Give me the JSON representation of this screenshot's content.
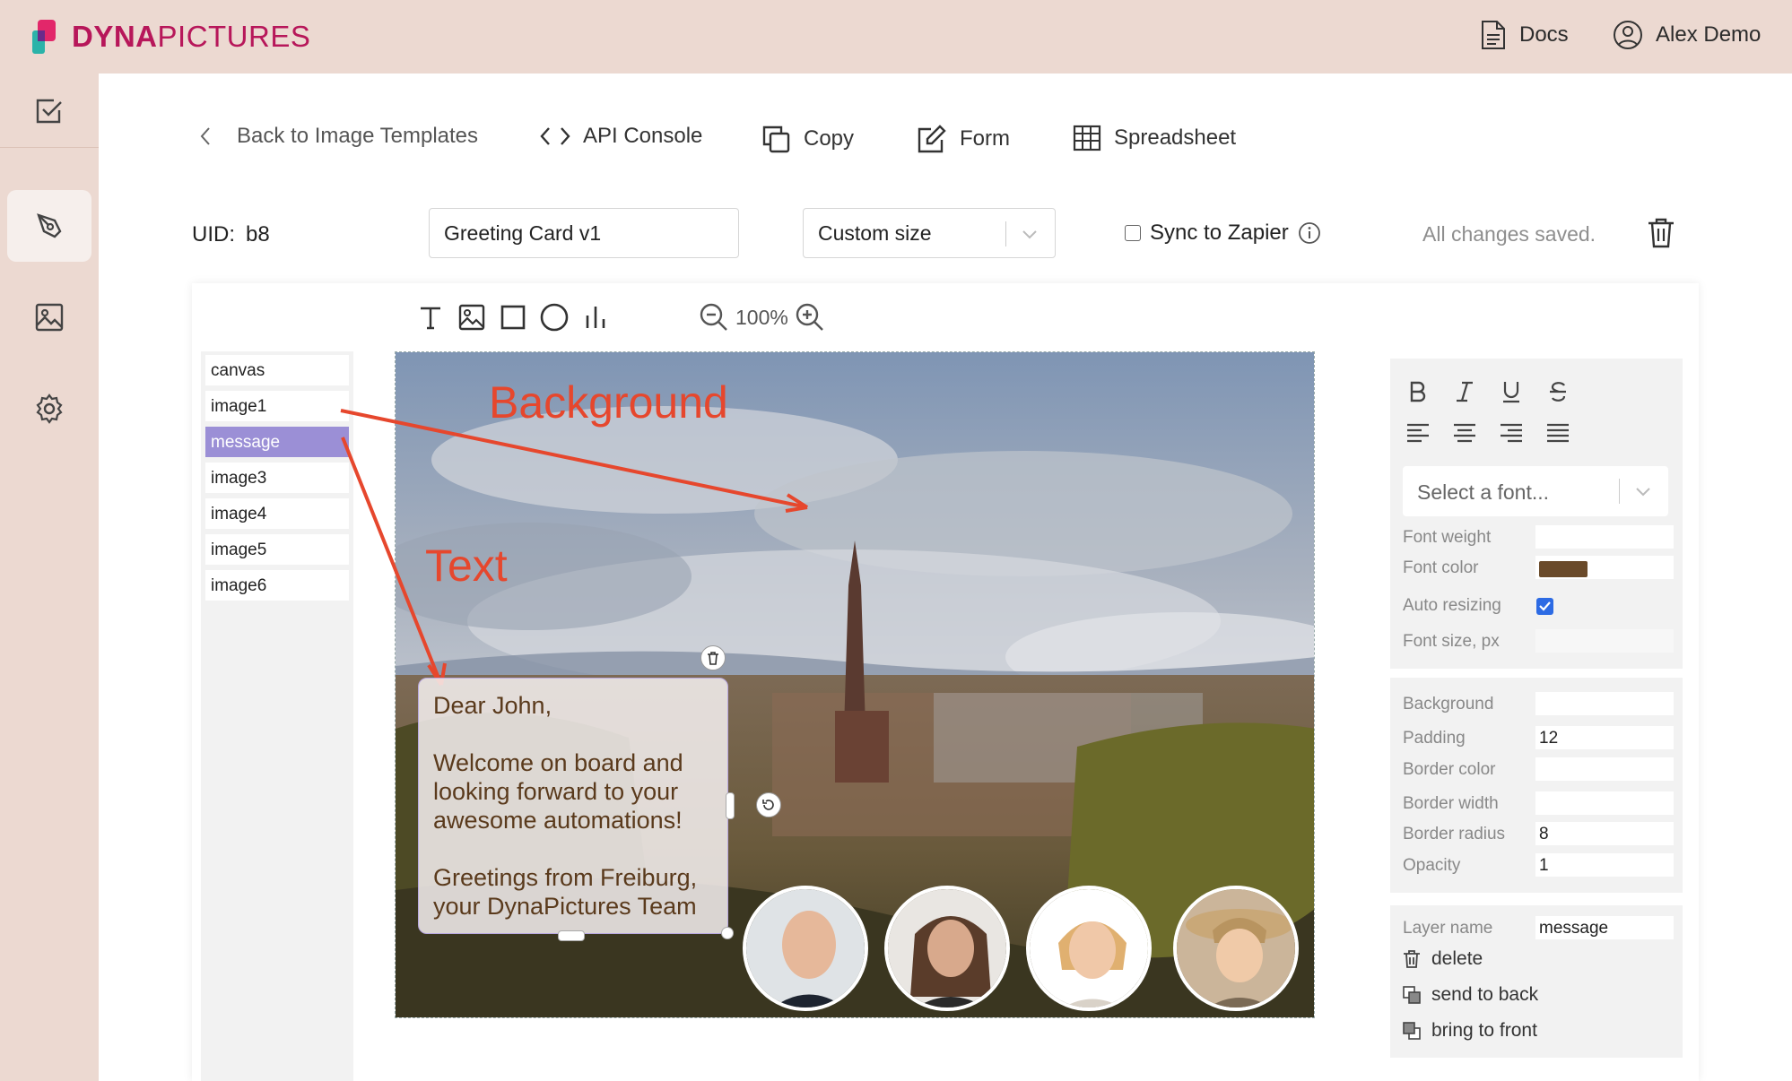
{
  "brand": {
    "name_bold": "DYNA",
    "name_light": "PICTURES"
  },
  "header": {
    "docs_label": "Docs",
    "user_label": "Alex Demo"
  },
  "nav": {
    "back_label": "Back to Image Templates",
    "api_label": "API Console",
    "copy_label": "Copy",
    "form_label": "Form",
    "spreadsheet_label": "Spreadsheet"
  },
  "meta": {
    "uid_label": "UID:",
    "uid_value": "b8",
    "template_name": "Greeting Card v1",
    "size_option": "Custom size",
    "zapier_label": "Sync to Zapier",
    "zapier_checked": false,
    "save_status": "All changes saved."
  },
  "zoom": {
    "level": "100%"
  },
  "layers": [
    "canvas",
    "image1",
    "message",
    "image3",
    "image4",
    "image5",
    "image6"
  ],
  "selected_layer": "message",
  "canvas": {
    "annotation_background": "Background",
    "annotation_text": "Text",
    "message_lines": [
      "Dear John,",
      "Welcome on board and looking forward to your awesome automations!",
      "Greetings from Freiburg, your DynaPictures Team"
    ]
  },
  "props": {
    "font_placeholder": "Select a font...",
    "font_weight_label": "Font weight",
    "font_color_label": "Font color",
    "font_color": "#6a4a2a",
    "auto_resizing_label": "Auto resizing",
    "auto_resizing": true,
    "font_size_label": "Font size, px",
    "background_label": "Background",
    "padding_label": "Padding",
    "padding_value": "12",
    "border_color_label": "Border color",
    "border_width_label": "Border width",
    "border_radius_label": "Border radius",
    "border_radius_value": "8",
    "opacity_label": "Opacity",
    "opacity_value": "1",
    "layer_name_label": "Layer name",
    "layer_name_value": "message"
  },
  "actions": {
    "delete": "delete",
    "send_back": "send to back",
    "bring_front": "bring to front"
  },
  "colors": {
    "accent": "#b7175a",
    "sidebar": "#ecd9d1",
    "selected_layer": "#9b8fd6",
    "annotation": "#e6472d"
  }
}
